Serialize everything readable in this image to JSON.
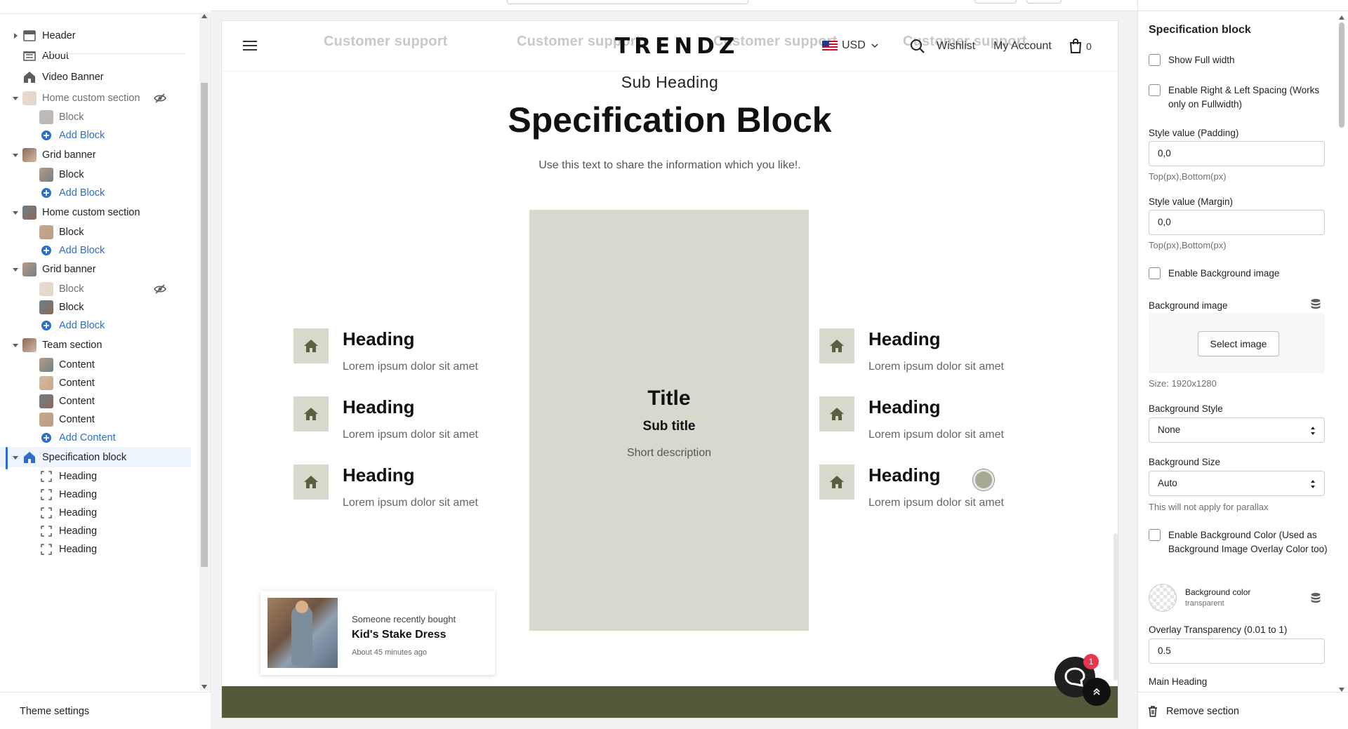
{
  "sidebar": {
    "rows": [
      {
        "kind": "section",
        "label": "Header",
        "caret": "right",
        "icon": "header-icon"
      },
      {
        "kind": "section",
        "label": "About",
        "caret": "none",
        "icon": "about-icon"
      },
      {
        "kind": "section",
        "label": "Video Banner",
        "caret": "none",
        "icon": "home-icon"
      },
      {
        "kind": "section",
        "label": "Home custom section",
        "caret": "down",
        "icon": "thumbnail-image",
        "hidden": true,
        "muted": true
      },
      {
        "kind": "child",
        "label": "Block",
        "icon": "thumbnail-image",
        "muted": true
      },
      {
        "kind": "add",
        "label": "Add Block"
      },
      {
        "kind": "section",
        "label": "Grid banner",
        "caret": "down",
        "icon": "thumbnail-image"
      },
      {
        "kind": "child",
        "label": "Block",
        "icon": "thumbnail-image"
      },
      {
        "kind": "add",
        "label": "Add Block"
      },
      {
        "kind": "section",
        "label": "Home custom section",
        "caret": "down",
        "icon": "thumbnail-image"
      },
      {
        "kind": "child",
        "label": "Block",
        "icon": "thumbnail-image"
      },
      {
        "kind": "add",
        "label": "Add Block"
      },
      {
        "kind": "section",
        "label": "Grid banner",
        "caret": "down",
        "icon": "thumbnail-image"
      },
      {
        "kind": "child",
        "label": "Block",
        "icon": "thumbnail-image",
        "hidden": true,
        "muted": true
      },
      {
        "kind": "child",
        "label": "Block",
        "icon": "thumbnail-image"
      },
      {
        "kind": "add",
        "label": "Add Block"
      },
      {
        "kind": "section",
        "label": "Team section",
        "caret": "down",
        "icon": "thumbnail-image"
      },
      {
        "kind": "child",
        "label": "Content",
        "icon": "thumbnail-image"
      },
      {
        "kind": "child",
        "label": "Content",
        "icon": "thumbnail-image"
      },
      {
        "kind": "child",
        "label": "Content",
        "icon": "thumbnail-image"
      },
      {
        "kind": "child",
        "label": "Content",
        "icon": "thumbnail-image"
      },
      {
        "kind": "add",
        "label": "Add Content"
      },
      {
        "kind": "section",
        "label": "Specification block",
        "caret": "down",
        "icon": "home-icon",
        "selected": true
      },
      {
        "kind": "child",
        "label": "Heading",
        "icon": "frame-icon"
      },
      {
        "kind": "child",
        "label": "Heading",
        "icon": "frame-icon"
      },
      {
        "kind": "child",
        "label": "Heading",
        "icon": "frame-icon"
      },
      {
        "kind": "child",
        "label": "Heading",
        "icon": "frame-icon"
      },
      {
        "kind": "child",
        "label": "Heading",
        "icon": "frame-icon"
      }
    ],
    "footer_label": "Theme settings"
  },
  "preview": {
    "ghost_support": [
      "Customer support",
      "Customer support",
      "Customer support",
      "Customer support"
    ],
    "header": {
      "logo": "TRENDZ",
      "currency": "USD",
      "wishlist": "Wishlist",
      "account": "My Account",
      "cart_count": "0"
    },
    "section": {
      "sub_heading": "Sub Heading",
      "heading": "Specification Block",
      "description": "Use this text to share the information which you like!.",
      "center_title": "Title",
      "center_subtitle": "Sub title",
      "center_description": "Short description",
      "items": [
        {
          "heading": "Heading",
          "text": "Lorem ipsum dolor sit amet"
        },
        {
          "heading": "Heading",
          "text": "Lorem ipsum dolor sit amet"
        },
        {
          "heading": "Heading",
          "text": "Lorem ipsum dolor sit amet"
        },
        {
          "heading": "Heading",
          "text": "Lorem ipsum dolor sit amet"
        },
        {
          "heading": "Heading",
          "text": "Lorem ipsum dolor sit amet"
        },
        {
          "heading": "Heading",
          "text": "Lorem ipsum dolor sit amet"
        }
      ]
    },
    "popup": {
      "line1": "Someone recently bought",
      "product": "Kid's Stake Dress",
      "time": "About 45 minutes ago"
    },
    "chat_badge": "1"
  },
  "settings": {
    "title": "Specification block",
    "show_full_width": "Show Full width",
    "enable_spacing": "Enable Right & Left Spacing (Works only on Fullwidth)",
    "padding_label": "Style value (Padding)",
    "padding_value": "0,0",
    "padding_help": "Top(px),Bottom(px)",
    "margin_label": "Style value (Margin)",
    "margin_value": "0,0",
    "margin_help": "Top(px),Bottom(px)",
    "enable_bg_image": "Enable Background image",
    "bg_image_label": "Background image",
    "select_image": "Select image",
    "bg_size_note": "Size: 1920x1280",
    "bg_style_label": "Background Style",
    "bg_style_value": "None",
    "bg_size_label": "Background Size",
    "bg_size_value": "Auto",
    "bg_size_help": "This will not apply for parallax",
    "enable_bg_color": "Enable Background Color (Used as Background Image Overlay Color too)",
    "bg_color_label": "Background color",
    "bg_color_value": "transparent",
    "overlay_label": "Overlay Transparency (0.01 to 1)",
    "overlay_value": "0.5",
    "main_heading_label": "Main Heading",
    "remove_section": "Remove section"
  },
  "colors": {
    "accent_blue": "#2c6ecb",
    "spec_panel": "#d7d9cc",
    "footer_band": "#535a3c",
    "badge_red": "#e8364f"
  }
}
